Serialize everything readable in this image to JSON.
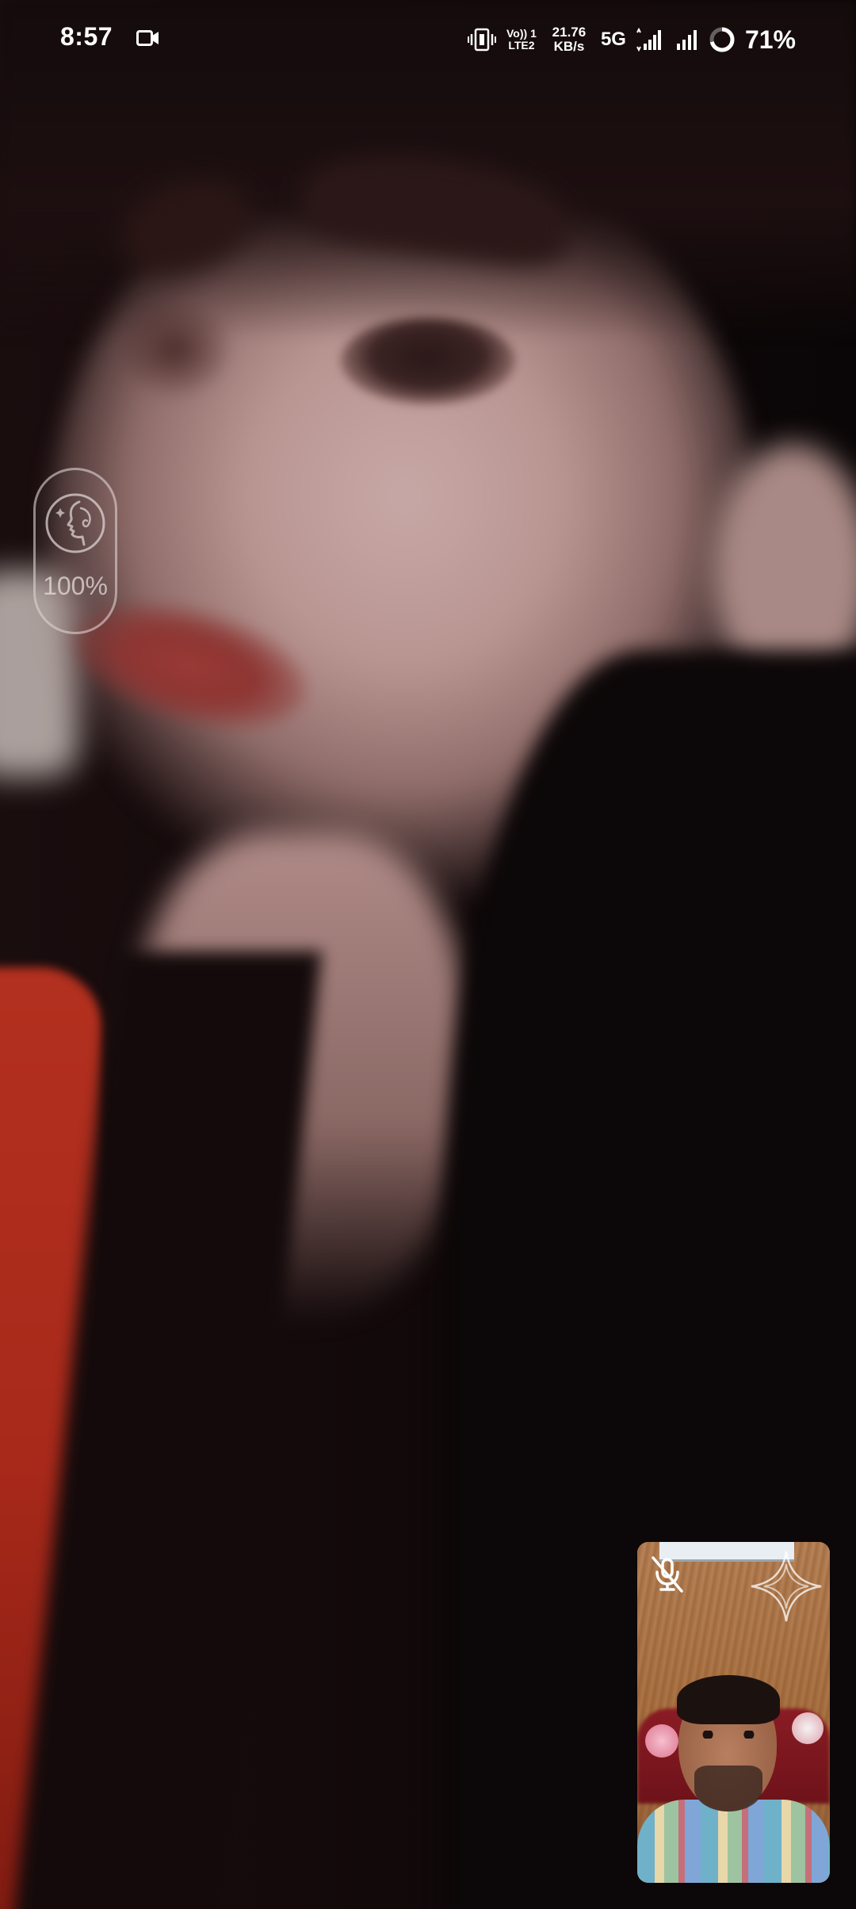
{
  "status_bar": {
    "time": "8:57",
    "volte_line1": "Vo)) 1",
    "volte_line2": "LTE2",
    "speed_value": "21.76",
    "speed_unit": "KB/s",
    "network_type": "5G",
    "battery_percent": "71%",
    "battery_level": 0.71
  },
  "beauty_filter": {
    "value": "100%",
    "icon": "face-profile-icon"
  },
  "self_preview": {
    "mute_icon": "mic-off-icon",
    "effect_icon": "sparkle-icon"
  },
  "colors": {
    "status_text": "#ffffff",
    "pill_border": "#dcd2d2"
  }
}
